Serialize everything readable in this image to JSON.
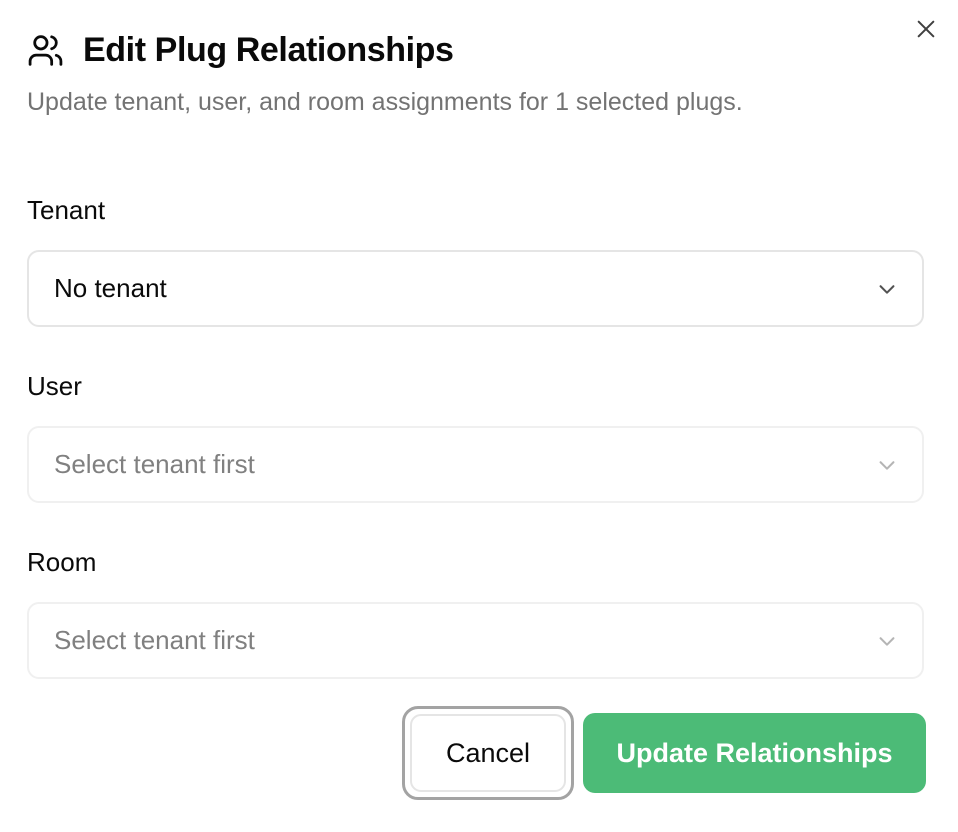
{
  "dialog": {
    "title": "Edit Plug Relationships",
    "description": "Update tenant, user, and room assignments for 1 selected plugs.",
    "title_icon": "users-icon",
    "close_icon": "close-icon"
  },
  "fields": {
    "tenant": {
      "label": "Tenant",
      "value": "No tenant",
      "disabled": false
    },
    "user": {
      "label": "User",
      "placeholder": "Select tenant first",
      "disabled": true
    },
    "room": {
      "label": "Room",
      "placeholder": "Select tenant first",
      "disabled": true
    }
  },
  "actions": {
    "cancel_label": "Cancel",
    "submit_label": "Update Relationships"
  },
  "colors": {
    "primary": "#4cbb77",
    "muted_text": "#737373",
    "border": "#e5e5e5"
  }
}
